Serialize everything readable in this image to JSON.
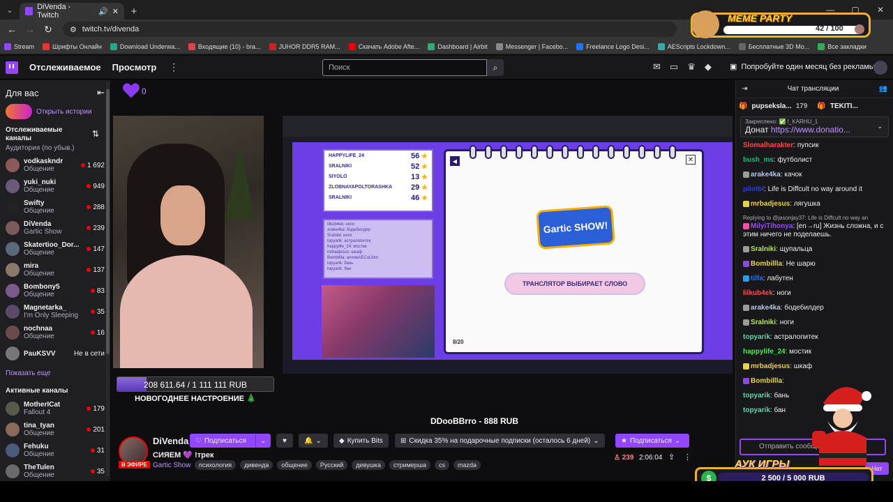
{
  "browser": {
    "tab_title": "DiVenda - Twitch",
    "url": "twitch.tv/divenda",
    "bookmarks": [
      "Stream",
      "Шрифты Онлайн",
      "Download Underwa...",
      "Входящие (10) - bra...",
      "JUHOR DDR5 RAM...",
      "Скачать Adobe Afte...",
      "Dashboard | Airbit",
      "Messenger | Facebo...",
      "Freelance Logo Desi...",
      "AEScripts Lockdown...",
      "Бесплатные 3D Мо...",
      "Все закладки"
    ]
  },
  "nav": {
    "following": "Отслеживаемое",
    "browse": "Просмотр",
    "search_placeholder": "Поиск",
    "promo": "Попробуйте один месяц без рекламы"
  },
  "sidebar": {
    "title": "Для вас",
    "stories": "Открыть истории",
    "followed_title": "Отслеживаемые каналы",
    "followed_sub": "Аудитория (по убыв.)",
    "followed": [
      {
        "name": "vodkaskndr",
        "cat": "Общение",
        "viewers": "1 692",
        "color": "#8a5a5a"
      },
      {
        "name": "yuki_nuki",
        "cat": "Общение",
        "viewers": "949",
        "color": "#6a5a7a"
      },
      {
        "name": "Swifty",
        "cat": "Общение",
        "viewers": "288",
        "color": "#222"
      },
      {
        "name": "DiVenda",
        "cat": "Gartic Show",
        "viewers": "239",
        "color": "#7a5a5a"
      },
      {
        "name": "Skatertioo_Dor...",
        "cat": "Общение",
        "viewers": "147",
        "color": "#5a6a7a"
      },
      {
        "name": "mira",
        "cat": "Общение",
        "viewers": "137",
        "color": "#8a7a6a"
      },
      {
        "name": "Bombony5",
        "cat": "Общение",
        "viewers": "83",
        "color": "#7a5a8a"
      },
      {
        "name": "Magnetarka_",
        "cat": "I'm Only Sleeping",
        "viewers": "35",
        "color": "#5a4a6a"
      },
      {
        "name": "nochnaa",
        "cat": "Общение",
        "viewers": "16",
        "color": "#6a4a4a"
      }
    ],
    "offline": {
      "name": "PauKSVV",
      "status": "Не в сети"
    },
    "show_more": "Показать еще",
    "active_title": "Активные каналы",
    "active": [
      {
        "name": "MotherICat",
        "cat": "Fallout 4",
        "viewers": "179",
        "color": "#5a5a4a"
      },
      {
        "name": "tina_tyan",
        "cat": "Общение",
        "viewers": "201",
        "color": "#8a6a5a"
      },
      {
        "name": "Fehuku",
        "cat": "Общение",
        "viewers": "31",
        "color": "#4a5a7a"
      },
      {
        "name": "TheTulen",
        "cat": "Общение",
        "viewers": "35",
        "color": "#6a6a6a"
      }
    ]
  },
  "stream": {
    "heart_count": "0",
    "donation_goal": "208 611.64 / 1 111 111 RUB",
    "donation_progress": 0.188,
    "mood": "НОВОГОДНЕЕ НАСТРОЕНИЕ 🎄",
    "last_donation": "DDooBBrro - 888 RUB",
    "scores": [
      {
        "name": "HAPPYLIFE_24",
        "pts": "56"
      },
      {
        "name": "SRALNIKI",
        "pts": "52"
      },
      {
        "name": "SIYOLO",
        "pts": "13"
      },
      {
        "name": "ZLOBNAYAPOLTORASHKA",
        "pts": "29"
      },
      {
        "name": "SRALNIKI",
        "pts": "46"
      }
    ],
    "mini_chat": [
      "lilkub4ek: ноги",
      "arake4ka: бодебилдер",
      "Sralniki: ноги",
      "topyarik: астралопитек",
      "happylife_24: мостик",
      "mrbadjesus: шкаф",
      "Bombillla: anoneAECutJom",
      "topyarik: бань",
      "topyarik: бан"
    ],
    "game_logo": "Gartic SHOW!",
    "game_status": "ТРАНСЛЯТОР ВЫБИРАЕТ СЛОВО",
    "round": "8/20"
  },
  "channel": {
    "name": "DiVenda",
    "live": "В ЭФИРЕ",
    "follow": "Подписаться",
    "bits": "Купить Bits",
    "discount": "Скидка 35% на подарочные подписки (осталось 6 дней)",
    "subscribe": "Подписаться",
    "title": "СИЯЕМ 💜 !трек",
    "game": "Gartic Show",
    "tags": [
      "психология",
      "дивенда",
      "общение",
      "Русский",
      "девушка",
      "стримерша",
      "cs",
      "mazda"
    ],
    "viewers": "239",
    "uptime": "2:06:04"
  },
  "chat": {
    "title": "Чат трансляции",
    "gifts": [
      {
        "user": "pupseksla...",
        "count": "179"
      },
      {
        "user": "TEKITI...",
        "count": ""
      }
    ],
    "pinned_label": "Закреплено: ✅ I_KARHU_1",
    "pinned_text": "Донат",
    "pinned_link": "https://www.donatio...",
    "messages": [
      {
        "user": "Slomalharakter",
        "color": "#ff4a4a",
        "text": "пупсик",
        "badge": ""
      },
      {
        "user": "bush_ms",
        "color": "#00c47a",
        "text": "футболист",
        "badge": ""
      },
      {
        "user": "arake4ka",
        "color": "#b5c8e8",
        "text": "качок",
        "badge": "#9a9a9a"
      },
      {
        "user": "pilotbl",
        "color": "#2a3aff",
        "text": "Life is Diffcult no way around it",
        "badge": ""
      },
      {
        "user": "mrbadjesus",
        "color": "#e8d24a",
        "text": "лягушка",
        "badge": "#e8d24a"
      },
      {
        "user": "MilyiTihonya",
        "color": "#9a4aff",
        "text": "[en→ru] Жизнь сложна, и с этим ничего не поделаешь.",
        "badge": "#ff4aaa",
        "reply": "Replying to @jasonjay37: Life is Diffcult no way an"
      },
      {
        "user": "Sralniki",
        "color": "#b5e85a",
        "text": "щупальца",
        "badge": "#9a9a9a"
      },
      {
        "user": "Bombillla",
        "color": "#e8d24a",
        "text": "Не шарю",
        "badge": "#8a4ad8"
      },
      {
        "user": "tilfa",
        "color": "#2a6aff",
        "text": "лабутен",
        "badge": "#2a9aff"
      },
      {
        "user": "lilkub4ek",
        "color": "#ff4a4a",
        "text": "ноги",
        "badge": ""
      },
      {
        "user": "arake4ka",
        "color": "#b5c8e8",
        "text": "бодебилдер",
        "badge": "#9a9a9a"
      },
      {
        "user": "Sralniki",
        "color": "#b5e85a",
        "text": "ноги",
        "badge": "#9a9a9a"
      },
      {
        "user": "topyarik",
        "color": "#5ad8a8",
        "text": "астралопитек",
        "badge": ""
      },
      {
        "user": "happylife_24",
        "color": "#4ae85a",
        "text": "мостик",
        "badge": ""
      },
      {
        "user": "mrbadjesus",
        "color": "#e8d24a",
        "text": "шкаф",
        "badge": "#e8d24a"
      },
      {
        "user": "Bombillla",
        "color": "#e8d24a",
        "text": "",
        "badge": "#8a4ad8"
      },
      {
        "user": "topyarik",
        "color": "#5ad8a8",
        "text": "бань",
        "badge": ""
      },
      {
        "user": "topyarik",
        "color": "#5ad8a8",
        "text": "бан",
        "badge": ""
      }
    ],
    "input_placeholder": "Отправить сообщение",
    "send": "Чат"
  },
  "overlays": {
    "meme_title": "MEME PARTY",
    "meme_count": "42 / 100",
    "auk_title": "АУК ИГРЫ",
    "auk_value": "2 500 / 5 000 RUB"
  }
}
